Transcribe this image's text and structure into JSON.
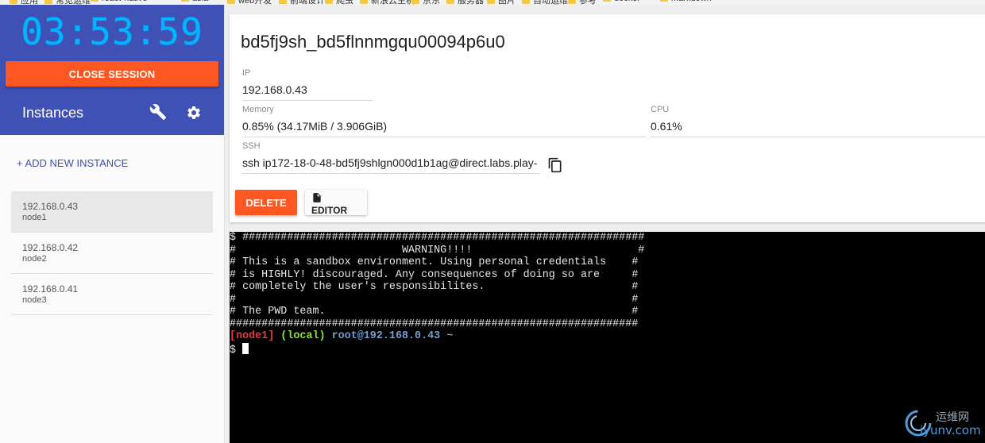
{
  "bookmarks": [
    "应用",
    "常见运维",
    "react-native",
    "asia",
    "web开发",
    "前端设计",
    "爬虫",
    "新浪云主机",
    "京东",
    "服务器",
    "图片",
    "自动运维",
    "参考",
    "docker",
    "markdown"
  ],
  "sidebar": {
    "timer": "03:53:59",
    "close_session_label": "CLOSE SESSION",
    "instances_title": "Instances",
    "add_instance_label": "+ ADD NEW INSTANCE",
    "instances": [
      {
        "ip": "192.168.0.43",
        "name": "node1",
        "active": true
      },
      {
        "ip": "192.168.0.42",
        "name": "node2",
        "active": false
      },
      {
        "ip": "192.168.0.41",
        "name": "node3",
        "active": false
      }
    ]
  },
  "instance": {
    "title": "bd5fj9sh_bd5flnnmgqu00094p6u0",
    "ip_label": "IP",
    "ip_value": "192.168.0.43",
    "memory_label": "Memory",
    "memory_value": "0.85% (34.17MiB / 3.906GiB)",
    "cpu_label": "CPU",
    "cpu_value": "0.61%",
    "ssh_label": "SSH",
    "ssh_value": "ssh ip172-18-0-48-bd5fj9shlgn000d1b1ag@direct.labs.play-",
    "delete_label": "DELETE",
    "editor_label": "EDITOR"
  },
  "terminal": {
    "lines": [
      "$ ###############################################################",
      "#                          WARNING!!!!                          #",
      "# This is a sandbox environment. Using personal credentials    #",
      "# is HIGHLY! discouraged. Any consequences of doing so are     #",
      "# completely the user's responsibilites.                       #",
      "#                                                              #",
      "# The PWD team.                                                #",
      "################################################################"
    ],
    "prompt_node": "[node1]",
    "prompt_local": "(local)",
    "prompt_user": "root@192.168.0.43 ~",
    "prompt_symbol": "$"
  },
  "watermark": {
    "cn": "运维网",
    "url": "iyunv.com"
  },
  "colors": {
    "primary": "#3f51b5",
    "accent": "#ff5722",
    "timer": "#00b4ff"
  }
}
